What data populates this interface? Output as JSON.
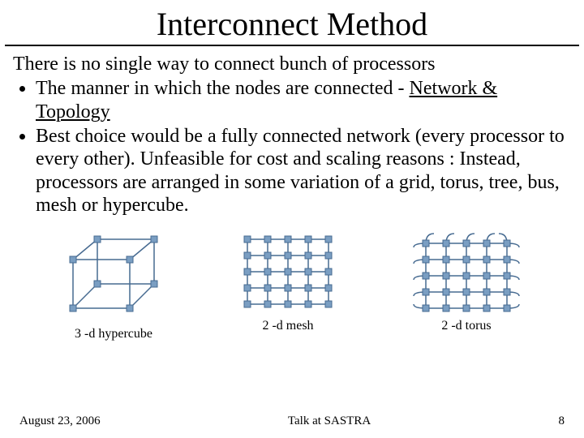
{
  "title": "Interconnect Method",
  "intro": "There is no single way to connect bunch of processors",
  "bullets": [
    {
      "pre": "The manner in which the nodes are connected - ",
      "underlined": "Network & Topology"
    },
    {
      "text": "Best choice would be a fully connected network (every processor to every other). Unfeasible for cost and scaling reasons : Instead, processors are arranged in some variation of a grid, torus, tree, bus, mesh or hypercube."
    }
  ],
  "diagrams": [
    {
      "caption": "3 -d hypercube"
    },
    {
      "caption": "2 -d mesh"
    },
    {
      "caption": "2 -d torus"
    }
  ],
  "footer": {
    "date": "August 23, 2006",
    "venue": "Talk at SASTRA",
    "page": "8"
  },
  "colors": {
    "node_fill": "#7a9ec2",
    "node_stroke": "#476b91",
    "edge": "#476b91"
  }
}
